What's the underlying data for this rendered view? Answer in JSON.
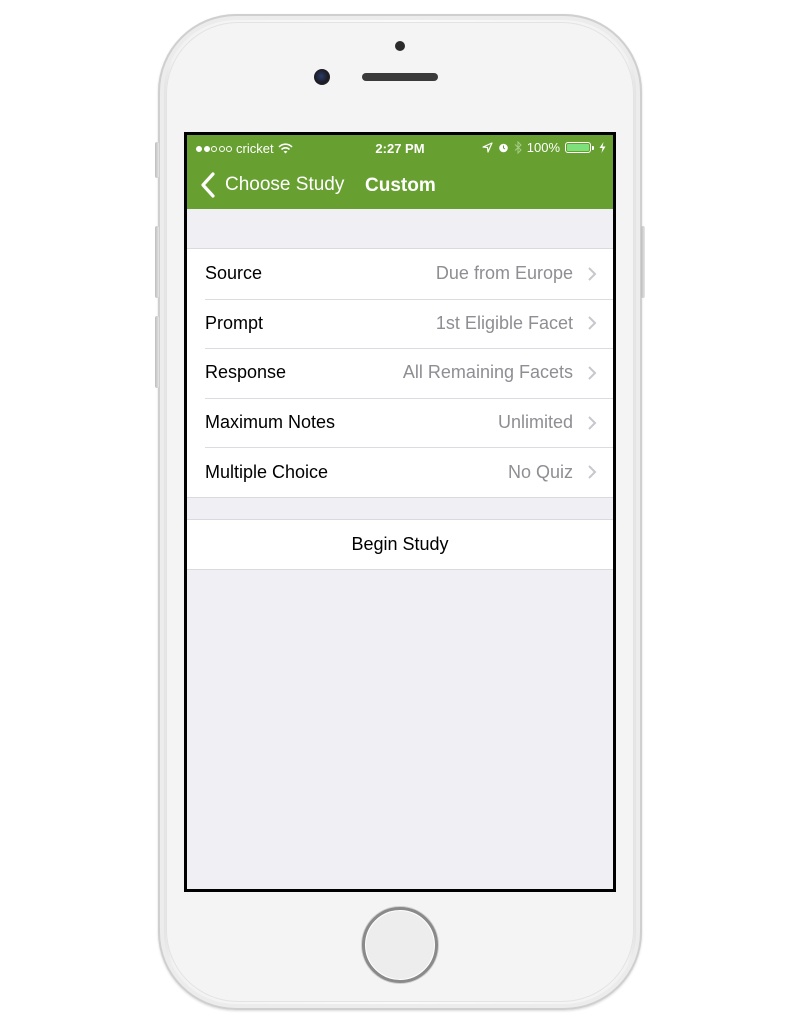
{
  "status_bar": {
    "carrier": "cricket",
    "signal_strength": 2,
    "signal_max": 5,
    "time": "2:27 PM",
    "battery_percent": "100%",
    "battery_level": 1.0,
    "icons": [
      "wifi-icon",
      "location-icon",
      "alarm-icon",
      "bluetooth-icon",
      "battery-icon",
      "charging-icon"
    ]
  },
  "nav": {
    "back_label": "Choose Study",
    "title": "Custom",
    "bar_color": "#67a031"
  },
  "settings": [
    {
      "label": "Source",
      "value": "Due from Europe"
    },
    {
      "label": "Prompt",
      "value": "1st Eligible Facet"
    },
    {
      "label": "Response",
      "value": "All Remaining Facets"
    },
    {
      "label": "Maximum Notes",
      "value": "Unlimited"
    },
    {
      "label": "Multiple Choice",
      "value": "No Quiz"
    }
  ],
  "action": {
    "label": "Begin Study"
  }
}
